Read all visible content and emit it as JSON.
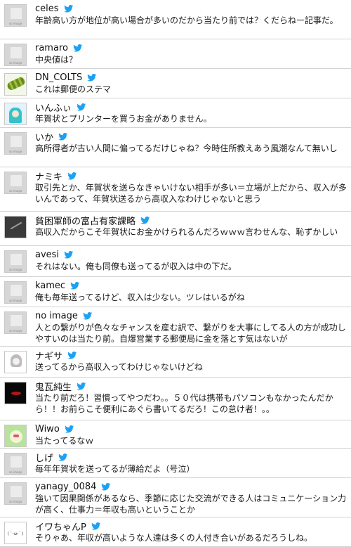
{
  "colors": {
    "bird": "#1da1f2",
    "divider": "#d2d2d2",
    "text": "#1a1a1a"
  },
  "avatar_label": "no image",
  "icon": "twitter-bird-icon",
  "comments": [
    {
      "name": "celes",
      "text": "年齢高い方が地位が高い場合が多いのだから当たり前では？くだらねー記事だ。",
      "avatar": "noimg"
    },
    {
      "name": "ramaro",
      "text": "中央値は？",
      "avatar": "noimg"
    },
    {
      "name": "DN_COLTS",
      "text": "これは郵便のステマ",
      "avatar": "green"
    },
    {
      "name": "いんふぃ",
      "text": "年賀状とプリンターを買うお金がありません。",
      "avatar": "miku"
    },
    {
      "name": "いか",
      "text": "高所得者が古い人間に偏ってるだけじゃね？今時住所教えあう風潮なんて無いし",
      "avatar": "noimg"
    },
    {
      "name": "ナミキ",
      "text": "取引先とか、年賀状を送らなきゃいけない相手が多い＝立場が上だから、収入が多いんであって、年賀状送るから高収入なわけじゃないと思う",
      "avatar": "noimg"
    },
    {
      "name": "貧困軍師の富占有家課略",
      "text": "高収入だからこそ年賀状にお金かけられるんだろｗｗｗ言わせんな、恥ずかしい",
      "avatar": "dark"
    },
    {
      "name": "avesi",
      "text": "それはない。俺も同僚も送ってるが収入は中の下だ。",
      "avatar": "noimg"
    },
    {
      "name": "kamec",
      "text": "俺も毎年送ってるけど、収入は少ない。ツレはいるがね",
      "avatar": "noimg"
    },
    {
      "name": "no image",
      "text": "人との繋がりが色々なチャンスを産む訳で、繋がりを大事にしてる人の方が成功しやすいのは当たり前。自爆営業する郵便局に金を落とす気はないが",
      "avatar": "noimg"
    },
    {
      "name": "ナギサ",
      "text": "送ってるから高収入ってわけじゃないけどね",
      "avatar": "girl"
    },
    {
      "name": "鬼瓦純生",
      "text": "当たり前だろ！習慣ってやつだわ。。５０代は携帯もパソコンもなかったんだから！！お前らこそ便利にあぐら書いてるだろ！この怠け者！。。",
      "avatar": "black"
    },
    {
      "name": "Wiwo",
      "text": "当たってるなｗ",
      "avatar": "wiwo"
    },
    {
      "name": "しげ",
      "text": "毎年年賀状を送ってるが薄給だよ（号泣）",
      "avatar": "noimg"
    },
    {
      "name": "yanagy_0084",
      "text": "強いて因果関係があるなら、季節に応じた交流ができる人はコミュニケーション力が高く、仕事力＝年収も高いということか",
      "avatar": "noimg"
    },
    {
      "name": "イワちゃんP",
      "text": "そりゃあ、年収が高いような人達は多くの人付き合いがあるだろうしね。",
      "avatar": "kao",
      "avatar_text": "(´･ω･`)"
    }
  ]
}
